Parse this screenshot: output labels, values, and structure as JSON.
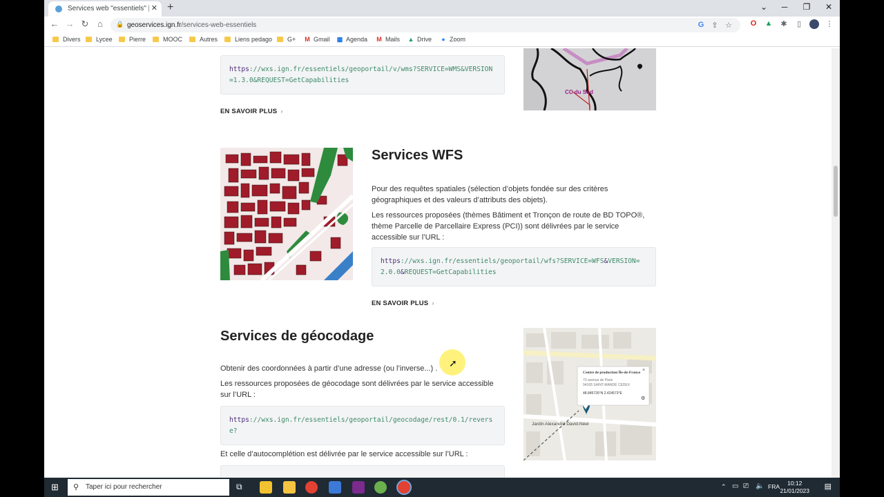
{
  "browser": {
    "tab_title": "Services web \"essentiels\" | Géoservices",
    "url_host": "geoservices.ign.fr",
    "url_path": "/services-web-essentiels",
    "new_tab_label": "+",
    "icons": {
      "back": "back-arrow-icon",
      "forward": "forward-arrow-icon",
      "reload": "reload-icon",
      "home": "home-icon",
      "close_tab": "close-icon",
      "minimize": "minimize-icon",
      "maximize": "maximize-icon",
      "close": "close-icon"
    }
  },
  "bookmarks": [
    {
      "label": "Divers",
      "icon": "folder-icon"
    },
    {
      "label": "Lycee",
      "icon": "folder-icon"
    },
    {
      "label": "Pierre",
      "icon": "folder-icon"
    },
    {
      "label": "MOOC",
      "icon": "folder-icon"
    },
    {
      "label": "Autres",
      "icon": "folder-icon"
    },
    {
      "label": "Liens pedago",
      "icon": "folder-icon"
    },
    {
      "label": "G+",
      "icon": "folder-icon"
    },
    {
      "label": "Gmail",
      "icon": "gmail-icon"
    },
    {
      "label": "Agenda",
      "icon": "calendar-icon"
    },
    {
      "label": "Mails",
      "icon": "gmail-icon"
    },
    {
      "label": "Drive",
      "icon": "drive-icon"
    },
    {
      "label": "Zoom",
      "icon": "zoom-icon"
    }
  ],
  "wms": {
    "url_scheme": "https",
    "url_body": "://wxs.ign.fr/essentiels/geoportail/v/wms?SERVICE=WMS&VERSION=1.3.0&REQUEST=GetCapabilities",
    "more_label": "EN SAVOIR PLUS",
    "map_label": "CC du Sud"
  },
  "wfs": {
    "title": "Services WFS",
    "para1": "Pour des requêtes spatiales (sélection d’objets fondée sur des critères géographiques et des valeurs d’attributs des objets).",
    "para2": "Les ressources proposées (thèmes Bâtiment et Tronçon de route de BD TOPO®, thème Parcelle de Parcellaire Express (PCI)) sont délivrées par le service accessible sur l’URL :",
    "url_scheme": "https",
    "url_host": "://wxs.ign.fr/essentiels/geoportail/wfs?",
    "url_p1": "SERVICE=WFS",
    "url_amp1": "&",
    "url_p2": "VERSION=2.0.0",
    "url_amp2": "&",
    "url_p3": "REQUEST=GetCapabilities",
    "more_label": "EN SAVOIR PLUS"
  },
  "geocodage": {
    "title": "Services de géocodage",
    "para1": "Obtenir des coordonnées à partir d’une adresse (ou l’inverse...) .",
    "para2": "Les ressources proposées de géocodage sont délivrées par le service accessible sur l’URL :",
    "url_scheme": "https",
    "url_body": "://wxs.ign.fr/essentiels/geoportail/geocodage/rest/0.1/reverse?",
    "para3": "Et celle d’autocomplétion est délivrée par le service accessible sur l’URL :",
    "map_popup_title": "Centre de production Île-de-France",
    "map_popup_addr1": "73 avenue de Paris",
    "map_popup_addr2": "94165 SAINT-MANDÉ CEDEX",
    "map_popup_coords": "48.845726°N 2.424573°E",
    "map_place": "Jardin Alexandra David-Néel"
  },
  "taskbar": {
    "search_placeholder": "Taper ici pour rechercher",
    "language": "FRA",
    "time": "10:12",
    "date": "21/01/2023"
  }
}
